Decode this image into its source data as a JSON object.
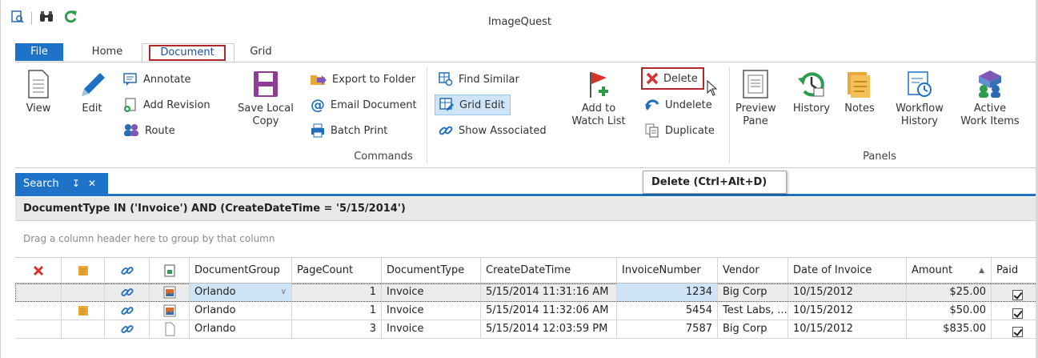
{
  "app": {
    "title": "ImageQuest"
  },
  "quick_access": {
    "icons": [
      "search-doc-icon",
      "binoculars-icon",
      "refresh-icon"
    ]
  },
  "tabs": {
    "file": "File",
    "home": "Home",
    "document": "Document",
    "grid": "Grid",
    "active": "Document"
  },
  "ribbon": {
    "view": "View",
    "edit": "Edit",
    "annotate": "Annotate",
    "add_revision": "Add Revision",
    "route": "Route",
    "save_local_line1": "Save Local",
    "save_local_line2": "Copy",
    "export_to_folder": "Export to Folder",
    "email_document": "Email Document",
    "batch_print": "Batch Print",
    "find_similar": "Find Similar",
    "grid_edit": "Grid Edit",
    "show_associated": "Show Associated",
    "add_to_line1": "Add to",
    "add_to_line2": "Watch List",
    "delete": "Delete",
    "undelete": "Undelete",
    "duplicate": "Duplicate",
    "preview_line1": "Preview",
    "preview_line2": "Pane",
    "history": "History",
    "notes": "Notes",
    "workflow_line1": "Workflow",
    "workflow_line2": "History",
    "active_line1": "Active",
    "active_line2": "Work Items",
    "group_commands": "Commands",
    "group_panels": "Panels"
  },
  "tooltip": {
    "text": "Delete (Ctrl+Alt+D)"
  },
  "search_panel": {
    "tab_label": "Search",
    "pin": "↧",
    "close": "✕",
    "query": "DocumentType IN ('Invoice') AND (CreateDateTime = '5/15/2014')",
    "group_hint": "Drag a column header here to group by that column"
  },
  "grid": {
    "columns": [
      "DocumentGroup",
      "PageCount",
      "DocumentType",
      "CreateDateTime",
      "InvoiceNumber",
      "Vendor",
      "Date of Invoice",
      "Amount",
      "Paid"
    ],
    "sort_column": "Amount",
    "rows": [
      {
        "group": "Orlando",
        "pages": "1",
        "type": "Invoice",
        "created": "5/15/2014 11:31:16 AM",
        "invoice": "1234",
        "vendor": "Big Corp",
        "date": "10/15/2012",
        "amount": "$25.00",
        "paid": true,
        "has_note": false,
        "thumb": "image"
      },
      {
        "group": "Orlando",
        "pages": "1",
        "type": "Invoice",
        "created": "5/15/2014 11:32:06 AM",
        "invoice": "5454",
        "vendor": "Test Labs, ...",
        "date": "10/15/2012",
        "amount": "$50.00",
        "paid": true,
        "has_note": true,
        "thumb": "image"
      },
      {
        "group": "Orlando",
        "pages": "3",
        "type": "Invoice",
        "created": "5/15/2014 12:03:59 PM",
        "invoice": "7587",
        "vendor": "Big Corp",
        "date": "10/15/2012",
        "amount": "$835.00",
        "paid": true,
        "has_note": false,
        "thumb": "blank"
      }
    ]
  },
  "colors": {
    "accent": "#1e73c8",
    "highlight_border": "#b3262b",
    "selection": "#cfe4f6",
    "delete_red": "#d9342b",
    "green": "#2e9c4e"
  }
}
